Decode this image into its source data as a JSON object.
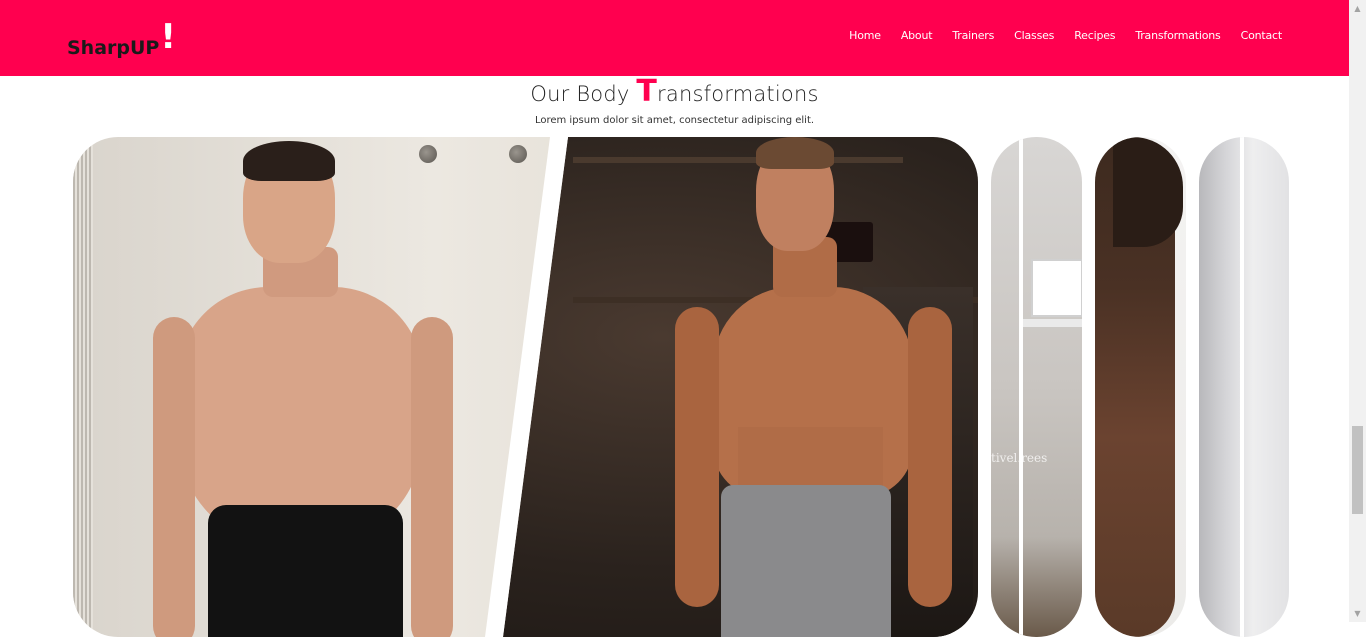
{
  "navbar": {
    "logo_text": "SharpUP",
    "logo_mark": "!",
    "links": [
      {
        "label": "Home"
      },
      {
        "label": "About"
      },
      {
        "label": "Trainers"
      },
      {
        "label": "Classes"
      },
      {
        "label": "Recipes"
      },
      {
        "label": "Transformations"
      },
      {
        "label": "Contact"
      }
    ]
  },
  "section": {
    "title_prefix": "Our Body ",
    "title_accent": "T",
    "title_suffix": "ransformations",
    "subtitle": "Lorem ipsum dolor sit amet, consectetur adipiscing elit."
  },
  "gallery": {
    "watermark": "tivel.rees"
  },
  "colors": {
    "brand": "#ff004f",
    "nav_text": "#ffffff",
    "logo_text": "#1a1a1a"
  },
  "icons": {
    "scroll_up": "scroll-up-arrow-icon",
    "scroll_down": "scroll-down-arrow-icon"
  }
}
